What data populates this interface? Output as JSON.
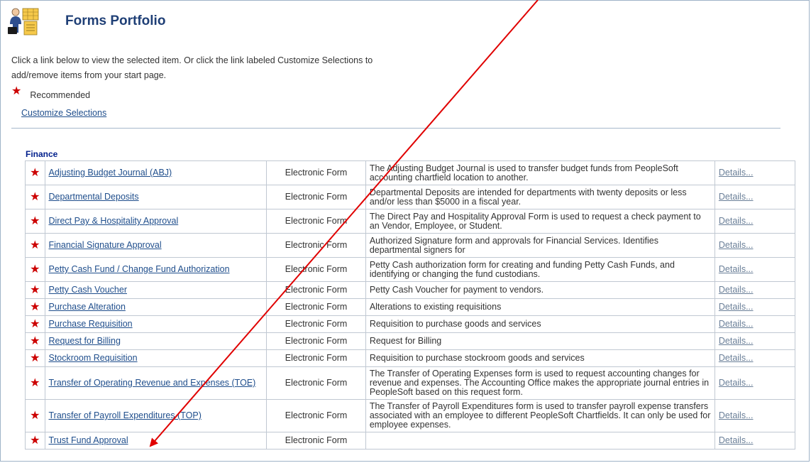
{
  "page": {
    "title": "Forms Portfolio"
  },
  "intro": {
    "line1": "Click a link below to view the selected item. Or click the link labeled Customize Selections to",
    "line2": "add/remove items from your start page."
  },
  "legend": {
    "recommended": "Recommended"
  },
  "customize_label": "Customize Selections",
  "section": {
    "title": "Finance"
  },
  "colors": {
    "star": "#cc0000",
    "link": "#1f4e8c",
    "heading": "#1f3f76",
    "arrow": "#e00000"
  },
  "rows": [
    {
      "name": "Adjusting Budget Journal (ABJ)",
      "type": "Electronic Form",
      "desc": "The Adjusting Budget Journal is used to transfer budget funds from PeopleSoft accounting chartfield location to another.",
      "details": "Details..."
    },
    {
      "name": "Departmental Deposits",
      "type": "Electronic Form",
      "desc": "Departmental Deposits are intended for departments with twenty deposits or less and/or less than $5000 in a fiscal year.",
      "details": "Details..."
    },
    {
      "name": "Direct Pay & Hospitality Approval",
      "type": "Electronic Form",
      "desc": "The Direct Pay and Hospitality Approval Form is used to request a check payment to an Vendor, Employee, or Student.",
      "details": "Details..."
    },
    {
      "name": "Financial Signature Approval",
      "type": "Electronic Form",
      "desc": "Authorized Signature form and approvals for Financial Services.  Identifies departmental signers for",
      "details": "Details..."
    },
    {
      "name": "Petty Cash Fund / Change Fund Authorization",
      "type": "Electronic Form",
      "desc": "Petty Cash authorization form for creating and funding Petty Cash Funds, and identifying or changing the fund custodians.",
      "details": "Details..."
    },
    {
      "name": "Petty Cash Voucher",
      "type": "Electronic Form",
      "desc": "Petty Cash Voucher for payment to vendors.",
      "details": "Details..."
    },
    {
      "name": "Purchase Alteration",
      "type": "Electronic Form",
      "desc": "Alterations to existing requisitions",
      "details": "Details..."
    },
    {
      "name": "Purchase Requisition",
      "type": "Electronic Form",
      "desc": "Requisition to purchase goods and services",
      "details": "Details..."
    },
    {
      "name": "Request for Billing",
      "type": "Electronic Form",
      "desc": "Request for Billing",
      "details": "Details..."
    },
    {
      "name": "Stockroom Requisition",
      "type": "Electronic Form",
      "desc": "Requisition to purchase stockroom goods and services",
      "details": "Details..."
    },
    {
      "name": "Transfer of Operating Revenue and Expenses (TOE)",
      "type": "Electronic Form",
      "desc": "The Transfer of Operating Expenses form is used to request accounting changes for revenue and expenses.  The Accounting Office makes the appropriate journal entries in PeopleSoft based on this request form.",
      "details": "Details..."
    },
    {
      "name": "Transfer of Payroll Expenditures (TOP)",
      "type": "Electronic Form",
      "desc": "The Transfer of Payroll Expenditures form is used to transfer payroll expense transfers associated with an employee to different PeopleSoft Chartfields.  It can only be used for employee expenses.",
      "details": "Details..."
    },
    {
      "name": "Trust Fund Approval",
      "type": "Electronic Form",
      "desc": "",
      "details": "Details..."
    }
  ]
}
